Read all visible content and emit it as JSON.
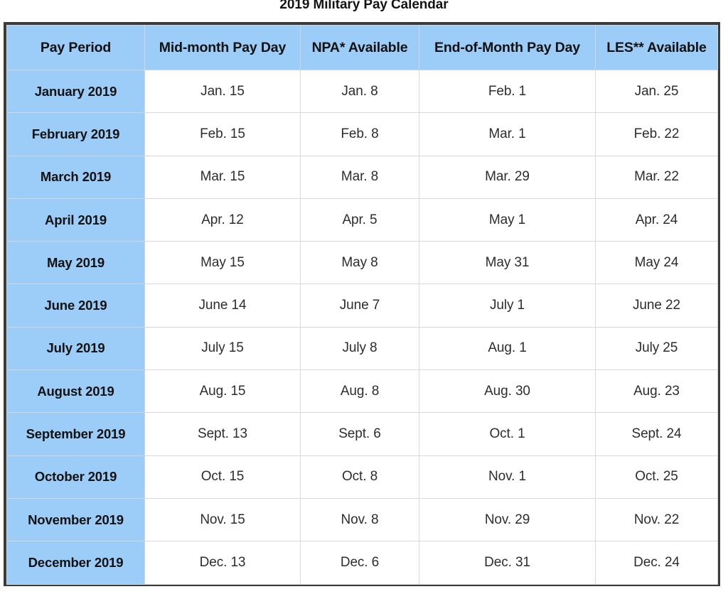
{
  "title": "2019 Military Pay Calendar",
  "colors": {
    "header_blue": "#9ccdf8",
    "period_blue": "#9ccdf8",
    "frame_border": "#3b3b3b",
    "cell_border": "#d8d8d8",
    "text": "#2d2d2d",
    "page_background": "#ffffff"
  },
  "table": {
    "columns": [
      "Pay Period",
      "Mid-month Pay Day",
      "NPA* Available",
      "End-of-Month Pay Day",
      "LES** Available"
    ],
    "rows": [
      {
        "period": "January 2019",
        "mid_month_pay_day": "Jan. 15",
        "npa_available": "Jan. 8",
        "end_of_month_pay_day": "Feb. 1",
        "les_available": "Jan. 25"
      },
      {
        "period": "February 2019",
        "mid_month_pay_day": "Feb. 15",
        "npa_available": "Feb. 8",
        "end_of_month_pay_day": "Mar. 1",
        "les_available": "Feb. 22"
      },
      {
        "period": "March 2019",
        "mid_month_pay_day": "Mar. 15",
        "npa_available": "Mar. 8",
        "end_of_month_pay_day": "Mar. 29",
        "les_available": "Mar. 22"
      },
      {
        "period": "April 2019",
        "mid_month_pay_day": "Apr. 12",
        "npa_available": "Apr. 5",
        "end_of_month_pay_day": "May 1",
        "les_available": "Apr. 24"
      },
      {
        "period": "May 2019",
        "mid_month_pay_day": "May 15",
        "npa_available": "May 8",
        "end_of_month_pay_day": "May 31",
        "les_available": "May 24"
      },
      {
        "period": "June 2019",
        "mid_month_pay_day": "June 14",
        "npa_available": "June 7",
        "end_of_month_pay_day": "July 1",
        "les_available": "June 22"
      },
      {
        "period": "July 2019",
        "mid_month_pay_day": "July 15",
        "npa_available": "July 8",
        "end_of_month_pay_day": "Aug. 1",
        "les_available": "July 25"
      },
      {
        "period": "August 2019",
        "mid_month_pay_day": "Aug. 15",
        "npa_available": "Aug. 8",
        "end_of_month_pay_day": "Aug. 30",
        "les_available": "Aug. 23"
      },
      {
        "period": "September 2019",
        "mid_month_pay_day": "Sept. 13",
        "npa_available": "Sept. 6",
        "end_of_month_pay_day": "Oct. 1",
        "les_available": "Sept. 24"
      },
      {
        "period": "October 2019",
        "mid_month_pay_day": "Oct. 15",
        "npa_available": "Oct. 8",
        "end_of_month_pay_day": "Nov. 1",
        "les_available": "Oct. 25"
      },
      {
        "period": "November 2019",
        "mid_month_pay_day": "Nov. 15",
        "npa_available": "Nov. 8",
        "end_of_month_pay_day": "Nov. 29",
        "les_available": "Nov. 22"
      },
      {
        "period": "December 2019",
        "mid_month_pay_day": "Dec. 13",
        "npa_available": "Dec. 6",
        "end_of_month_pay_day": "Dec. 31",
        "les_available": "Dec. 24"
      }
    ]
  }
}
